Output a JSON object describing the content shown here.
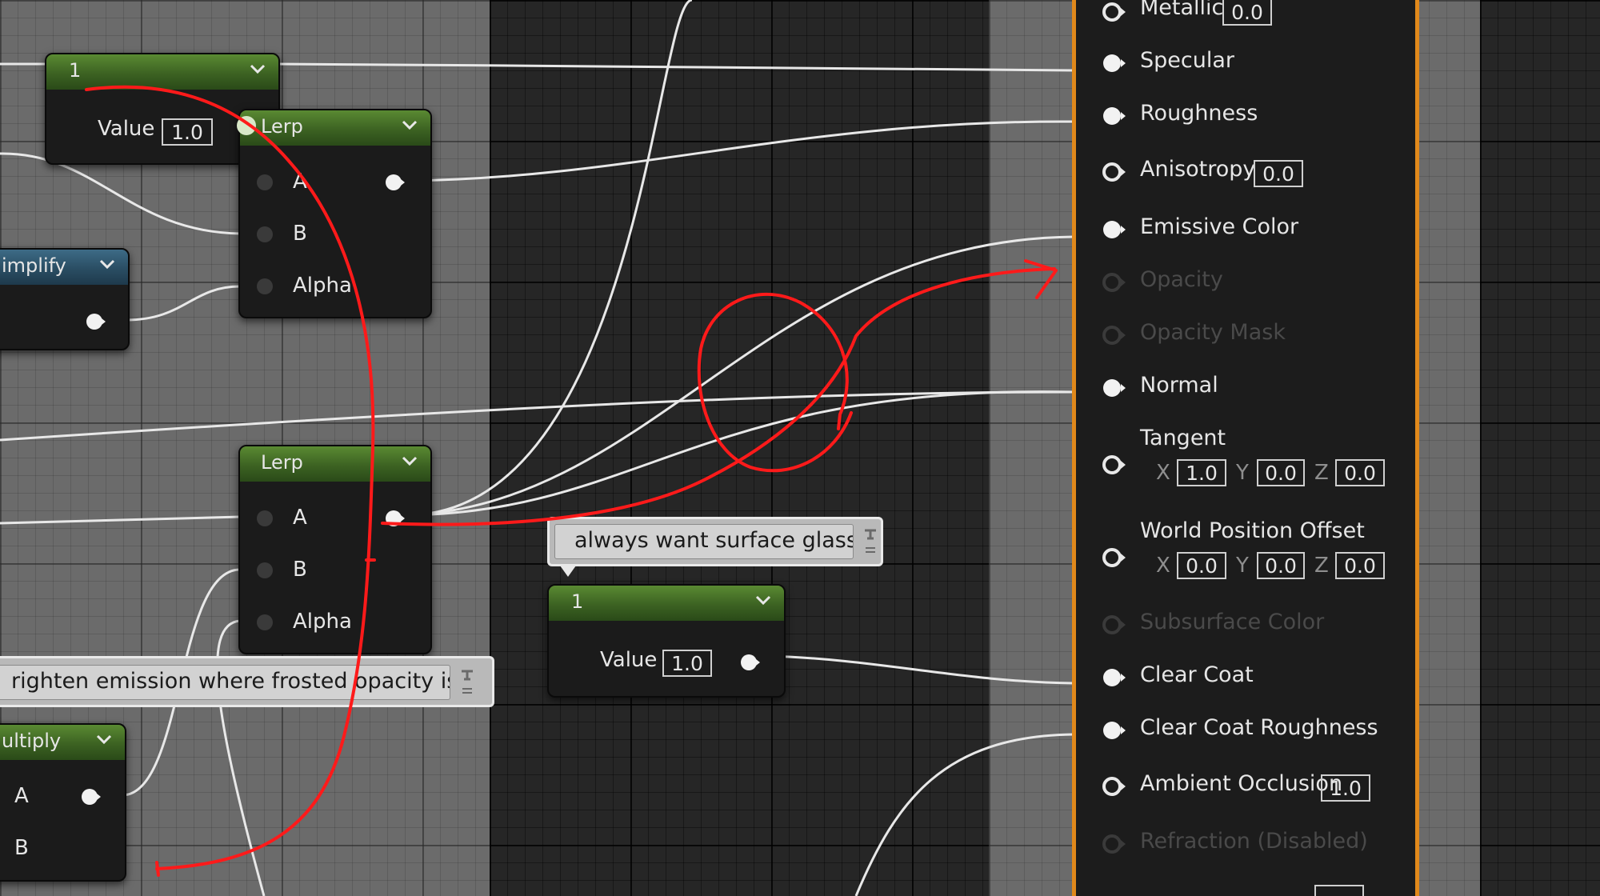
{
  "nodes": {
    "constant_top": {
      "title": "1",
      "value_label": "Value",
      "value": "1.0"
    },
    "lerp_top": {
      "title": "Lerp",
      "pins": [
        "A",
        "B",
        "Alpha"
      ]
    },
    "simplify_partial": {
      "title": "implify"
    },
    "lerp_bottom": {
      "title": "Lerp",
      "pins": [
        "A",
        "B",
        "Alpha"
      ]
    },
    "constant_mid": {
      "title": "1",
      "value_label": "Value",
      "value": "1.0"
    },
    "multiply_partial": {
      "title": "ultiply",
      "pins": [
        "A",
        "B"
      ]
    }
  },
  "comments": {
    "surface_glass": "always want surface glass",
    "emission": "righten emission where frosted opacity is low"
  },
  "material": {
    "metallic": {
      "label": "Metallic",
      "value": "0.0"
    },
    "specular": {
      "label": "Specular"
    },
    "roughness": {
      "label": "Roughness"
    },
    "anisotropy": {
      "label": "Anisotropy",
      "value": "0.0"
    },
    "emissive_color": {
      "label": "Emissive Color"
    },
    "opacity": {
      "label": "Opacity"
    },
    "opacity_mask": {
      "label": "Opacity Mask"
    },
    "normal": {
      "label": "Normal"
    },
    "tangent": {
      "label": "Tangent",
      "x_label": "X",
      "y_label": "Y",
      "z_label": "Z",
      "x": "1.0",
      "y": "0.0",
      "z": "0.0"
    },
    "world_position_offset": {
      "label": "World Position Offset",
      "x_label": "X",
      "y_label": "Y",
      "z_label": "Z",
      "x": "0.0",
      "y": "0.0",
      "z": "0.0"
    },
    "subsurface_color": {
      "label": "Subsurface Color"
    },
    "clear_coat": {
      "label": "Clear Coat"
    },
    "clear_coat_roughness": {
      "label": "Clear Coat Roughness"
    },
    "ambient_occlusion": {
      "label": "Ambient Occlusion",
      "value": "1.0"
    },
    "refraction": {
      "label": "Refraction (Disabled)"
    }
  },
  "colors": {
    "material_border": "#e1891b",
    "node_header_green": "#4a7a2a",
    "annotation_red": "#ff1a1a",
    "wire": "#e8e8e8"
  }
}
